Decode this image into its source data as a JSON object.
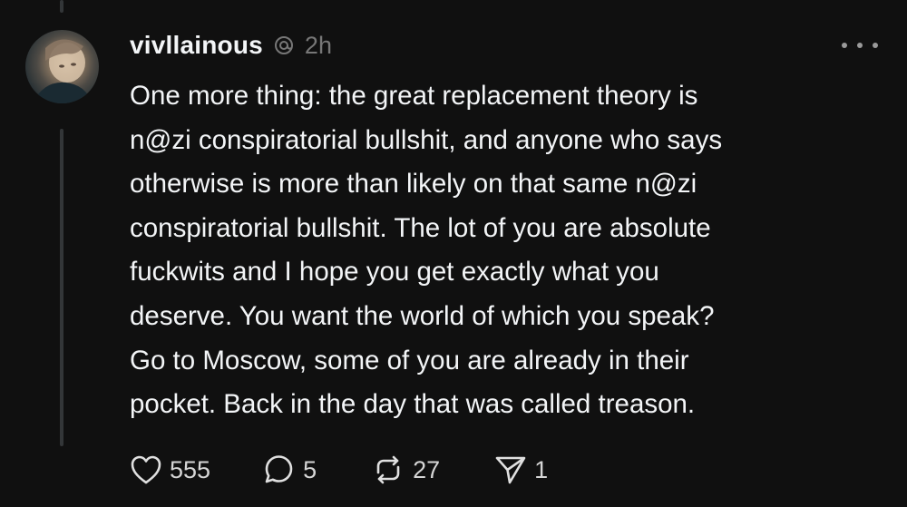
{
  "post": {
    "username": "vivllainous",
    "time": "2h",
    "text_lines": [
      "One more thing: the great replacement theory is",
      "n@zi conspiratorial bullshit, and anyone who says",
      "otherwise is more than likely on that same n@zi",
      "conspiratorial bullshit. The lot of you are absolute",
      "fuckwits and I hope you get exactly what you",
      "deserve. You want the world of which you speak?",
      "Go to Moscow, some of you are already in their",
      "pocket. Back in the day that was called treason."
    ]
  },
  "actions": {
    "likes": "555",
    "replies": "5",
    "reposts": "27",
    "shares": "1"
  },
  "icons": {
    "like": "heart-icon",
    "reply": "speech-bubble-icon",
    "repost": "repost-arrows-icon",
    "share": "send-plane-icon",
    "more": "more-dots-icon",
    "thread": "threads-logo-icon"
  },
  "colors": {
    "background": "#101010",
    "text": "#f3f5f7",
    "muted": "#777777",
    "thread_line": "#333638"
  }
}
